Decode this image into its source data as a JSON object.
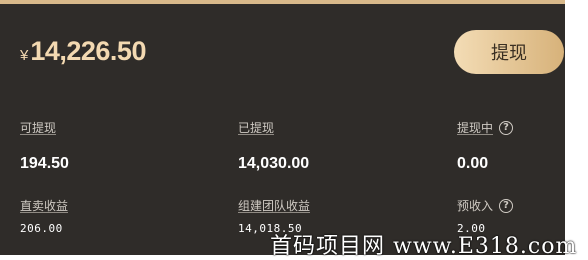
{
  "balance": {
    "currency_symbol": "¥",
    "amount": "14,226.50"
  },
  "withdraw_button": {
    "label": "提现"
  },
  "stats_row1": [
    {
      "label": "可提现",
      "value": "194.50",
      "help": false
    },
    {
      "label": "已提现",
      "value": "14,030.00",
      "help": false
    },
    {
      "label": "提现中",
      "value": "0.00",
      "help": true
    }
  ],
  "stats_row2": [
    {
      "label": "直卖收益",
      "value": "206.00",
      "help": false
    },
    {
      "label": "组建团队收益",
      "value": "14,018.50",
      "help": false
    },
    {
      "label": "预收入",
      "value": "2.00",
      "help": true
    }
  ],
  "help_glyph": "?",
  "watermark": "首码项目网 www.E318.com",
  "colors": {
    "card_bg": "#2f2c29",
    "accent_gold": "#f3d9b1",
    "button_gradient_start": "#f3dcb5",
    "button_gradient_end": "#d7b27a"
  }
}
